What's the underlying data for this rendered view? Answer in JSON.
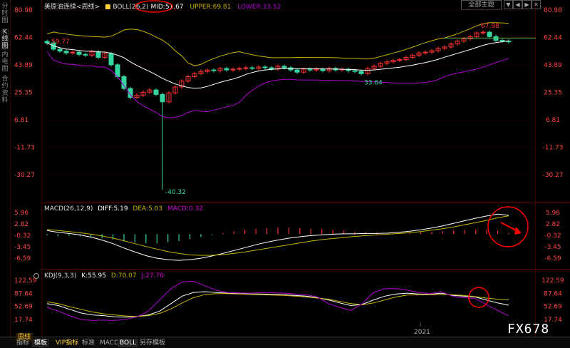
{
  "left_rail": [
    "分时图",
    "K线图",
    "内电图",
    "合约资料"
  ],
  "header": {
    "symbol": "美原油连续<周线>",
    "boll_label": "BOLL(26,2)",
    "mid": "MID:51.67",
    "upper": "UPPER:69.81",
    "lower": "LOWER:33.52",
    "theme_button": "全部主题",
    "controls": [
      "▼",
      "◀",
      "▶",
      "✕"
    ]
  },
  "macd_header": {
    "label": "MACD(26,12,9)",
    "diff": "DIFF:5.19",
    "dea": "DEA:5.03",
    "macd": "MACD:0.32"
  },
  "kdj_header": {
    "label": "KDJ(9,3,3)",
    "k": "K:55.95",
    "d": "D:70.07",
    "j": "J:27.70"
  },
  "bottom_tabs": [
    "周线",
    "指标",
    "模板",
    "VIP指标",
    "标准",
    "MACD",
    "BOLL",
    "另存模板"
  ],
  "x_axis_label": "2021",
  "watermark": "FX678",
  "colors": {
    "up": "#ff3333",
    "down": "#33d6a0",
    "mid": "#ffffff",
    "upper": "#c8b400",
    "lower": "#b000d0",
    "axis": "#ff4444",
    "annotation": "#ff0000"
  },
  "chart_data": [
    {
      "type": "candlestick",
      "title": "美原油连续<周线>",
      "ylim": [
        -40.32,
        80.98
      ],
      "ticks": [
        80.98,
        62.44,
        43.89,
        25.35,
        6.81,
        -11.73,
        -30.27
      ],
      "price_labels": {
        "high": 67.98,
        "low": -40.32,
        "mid_low": 33.64,
        "start": 59.77
      },
      "series_close": [
        58.8,
        54.5,
        53.2,
        52.0,
        52.5,
        51.0,
        50.5,
        52.8,
        49.0,
        51.5,
        44.0,
        36.0,
        28.0,
        22.0,
        23.5,
        25.5,
        27.0,
        24.0,
        19.0,
        25.0,
        29.0,
        33.0,
        36.0,
        38.0,
        39.5,
        40.5,
        40.0,
        41.5,
        40.5,
        41.0,
        41.5,
        42.0,
        41.5,
        42.5,
        42.0,
        41.0,
        43.0,
        42.0,
        40.5,
        39.0,
        41.0,
        40.5,
        41.0,
        40.0,
        41.5,
        40.5,
        41.0,
        40.0,
        39.5,
        38.0,
        41.5,
        43.0,
        45.0,
        46.0,
        47.0,
        47.5,
        49.0,
        50.5,
        52.0,
        52.5,
        53.5,
        55.0,
        56.0,
        58.0,
        60.0,
        61.5,
        63.0,
        65.5,
        66.0,
        63.0,
        60.5,
        60.0,
        59.5
      ]
    },
    {
      "type": "line",
      "title": "MACD(26,12,9)",
      "ticks": [
        5.96,
        2.82,
        -0.32,
        -3.45,
        -6.59
      ],
      "series": [
        {
          "name": "DIFF",
          "values": [
            1.0,
            0.5,
            0.2,
            -0.2,
            -0.8,
            -1.6,
            -2.6,
            -3.8,
            -4.9,
            -5.9,
            -6.6,
            -7.0,
            -7.2,
            -7.0,
            -6.6,
            -6.0,
            -5.3,
            -4.5,
            -3.7,
            -2.9,
            -2.2,
            -1.6,
            -1.1,
            -0.7,
            -0.4,
            -0.2,
            0.0,
            0.1,
            0.1,
            0.2,
            0.2,
            0.3,
            0.5,
            0.8,
            1.2,
            1.7,
            2.3,
            3.0,
            3.7,
            4.4,
            5.0,
            5.5,
            5.19
          ]
        },
        {
          "name": "DEA",
          "values": [
            1.3,
            1.0,
            0.7,
            0.4,
            0.0,
            -0.5,
            -1.1,
            -1.8,
            -2.6,
            -3.4,
            -4.1,
            -4.8,
            -5.3,
            -5.7,
            -5.8,
            -5.8,
            -5.6,
            -5.3,
            -4.9,
            -4.4,
            -3.9,
            -3.4,
            -2.9,
            -2.4,
            -1.9,
            -1.5,
            -1.2,
            -0.9,
            -0.6,
            -0.4,
            -0.2,
            0.0,
            0.2,
            0.4,
            0.7,
            1.1,
            1.5,
            2.0,
            2.6,
            3.2,
            3.8,
            4.5,
            5.03
          ]
        },
        {
          "name": "MACD",
          "values": [
            -0.3,
            -0.5,
            -0.5,
            -0.6,
            -0.8,
            -1.1,
            -1.5,
            -2.0,
            -2.3,
            -2.5,
            -2.5,
            -2.2,
            -1.9,
            -1.3,
            -0.8,
            -0.2,
            0.3,
            0.8,
            1.2,
            1.5,
            1.7,
            1.8,
            1.8,
            1.7,
            1.5,
            1.3,
            1.2,
            1.0,
            0.7,
            0.6,
            0.4,
            0.3,
            0.3,
            0.4,
            0.5,
            0.6,
            0.8,
            1.0,
            1.1,
            1.2,
            1.2,
            1.0,
            0.32
          ]
        }
      ]
    },
    {
      "type": "line",
      "title": "KDJ(9,3,3)",
      "ticks": [
        122.59,
        87.64,
        52.69,
        17.74
      ],
      "series": [
        {
          "name": "K",
          "values": [
            60,
            55,
            45,
            35,
            30,
            28,
            25,
            24,
            26,
            30,
            40,
            60,
            80,
            90,
            92,
            90,
            88,
            87,
            86,
            86,
            85,
            84,
            82,
            80,
            76,
            70,
            62,
            55,
            58,
            70,
            80,
            86,
            88,
            86,
            85,
            88,
            82,
            80,
            78,
            70,
            62,
            55.95
          ]
        },
        {
          "name": "D",
          "values": [
            65,
            60,
            52,
            45,
            38,
            33,
            30,
            27,
            26,
            28,
            34,
            46,
            62,
            76,
            84,
            87,
            87,
            86,
            85,
            84,
            83,
            82,
            80,
            78,
            75,
            72,
            66,
            60,
            57,
            62,
            70,
            78,
            83,
            84,
            84,
            85,
            84,
            82,
            79,
            75,
            72,
            70.07
          ]
        },
        {
          "name": "J",
          "values": [
            50,
            40,
            28,
            18,
            15,
            16,
            15,
            18,
            25,
            40,
            70,
            100,
            118,
            120,
            108,
            96,
            90,
            89,
            88,
            90,
            89,
            88,
            86,
            84,
            78,
            60,
            50,
            42,
            60,
            90,
            100,
            100,
            96,
            90,
            87,
            92,
            80,
            76,
            74,
            58,
            42,
            27.7
          ]
        }
      ]
    }
  ]
}
